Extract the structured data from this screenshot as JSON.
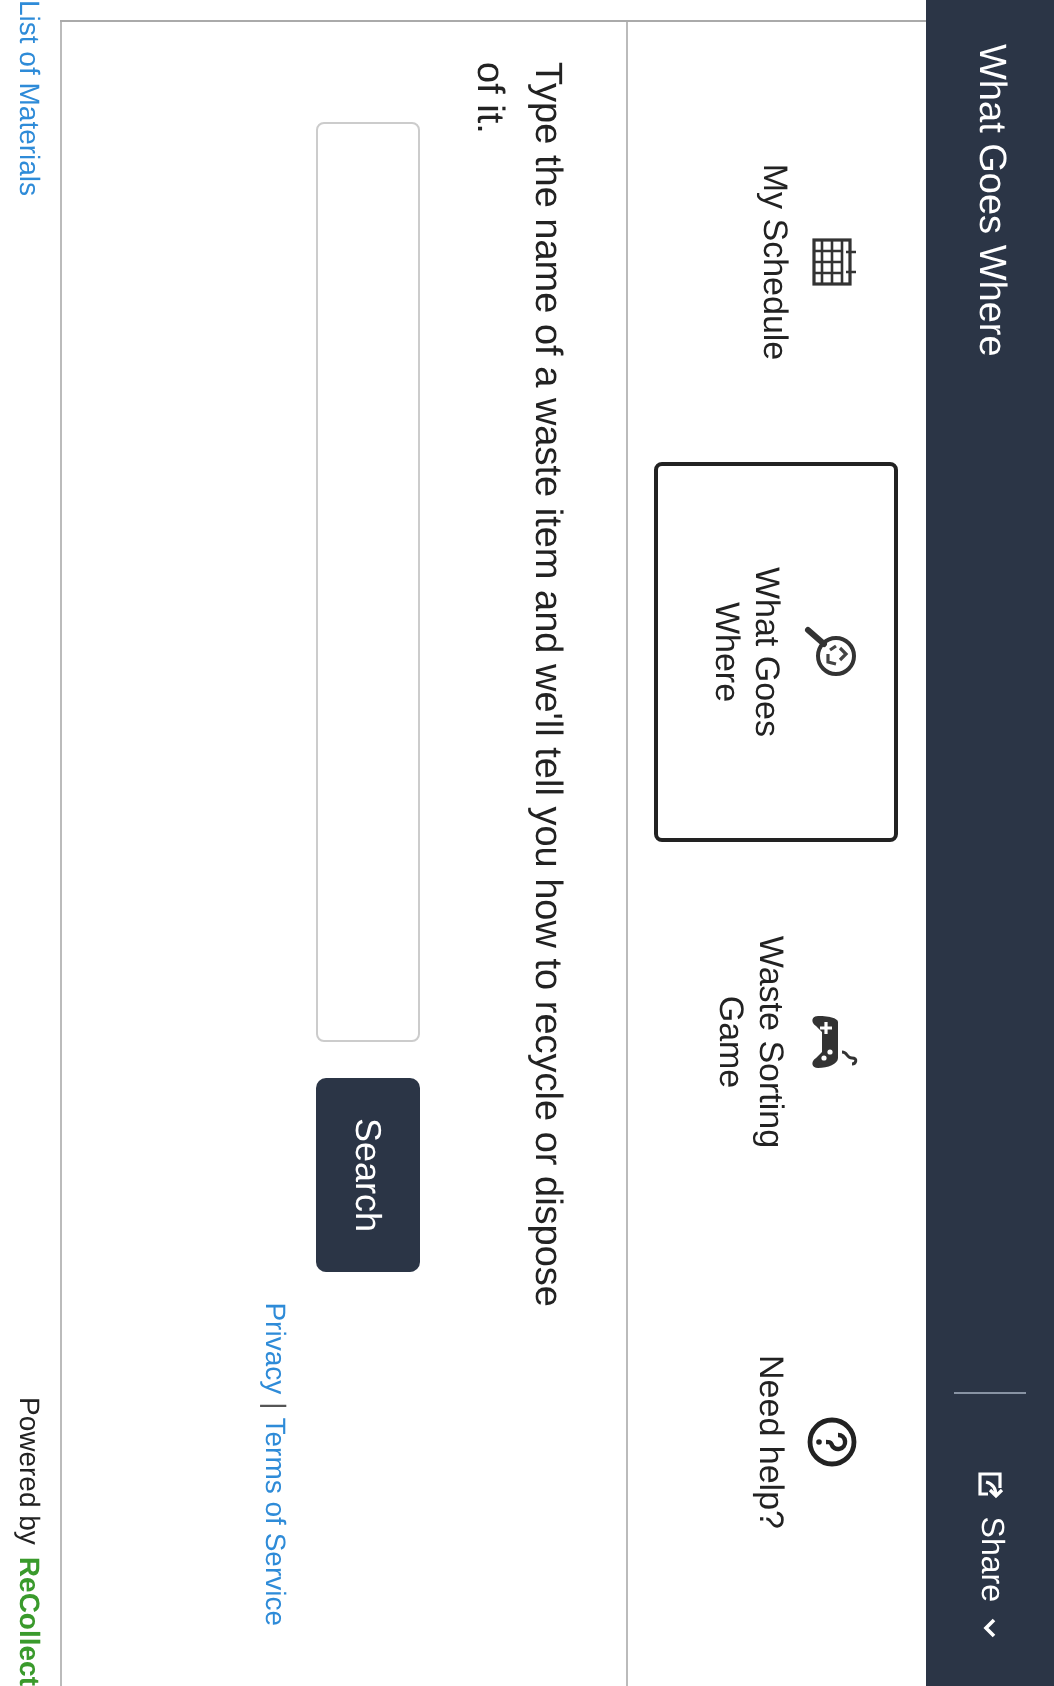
{
  "header": {
    "title": "What Goes Where",
    "share": {
      "label": "Share"
    }
  },
  "tabs": [
    {
      "label": "My Schedule",
      "selected": false
    },
    {
      "label": "What Goes Where",
      "selected": true
    },
    {
      "label": "Waste Sorting Game",
      "selected": false
    },
    {
      "label": "Need help?",
      "selected": false
    }
  ],
  "intro": "Type the name of a waste item and we'll tell you how to recycle or dispose of it.",
  "search": {
    "button": "Search"
  },
  "links": {
    "privacy": "Privacy",
    "separator": "|",
    "terms": "Terms of Service"
  },
  "footer": {
    "materials": "List of Materials",
    "powered_by": "Powered by",
    "brand": "ReCollect"
  }
}
